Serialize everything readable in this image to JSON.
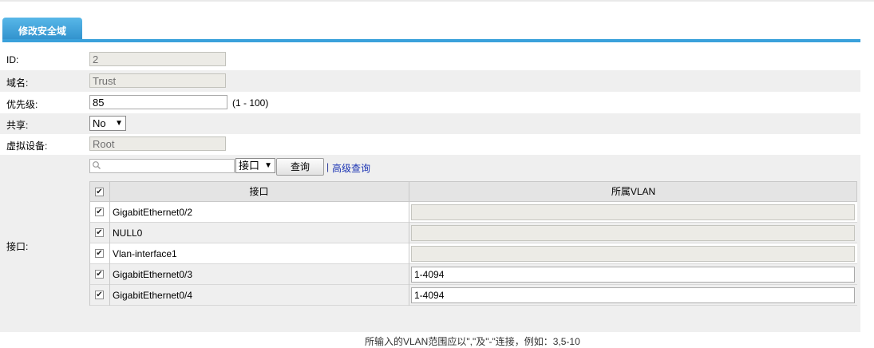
{
  "tab": {
    "title": "修改安全域"
  },
  "form": {
    "id": {
      "label": "ID:",
      "value": "2"
    },
    "domain_name": {
      "label": "域名:",
      "value": "Trust"
    },
    "priority": {
      "label": "优先级:",
      "value": "85",
      "range_hint": "(1 - 100)"
    },
    "share": {
      "label": "共享:",
      "selected": "No"
    },
    "virtual_device": {
      "label": "虚拟设备:",
      "value": "Root"
    },
    "interface": {
      "label": "接口:"
    }
  },
  "search": {
    "placeholder": "",
    "type_selected": "接口",
    "query_button": "查询",
    "separator": "|",
    "advanced_link": "高级查询"
  },
  "table": {
    "headers": {
      "interface": "接口",
      "vlan": "所属VLAN"
    },
    "rows": [
      {
        "name": "GigabitEthernet0/2",
        "vlan": "",
        "checked": true,
        "vlan_editable": false
      },
      {
        "name": "NULL0",
        "vlan": "",
        "checked": true,
        "vlan_editable": false
      },
      {
        "name": "Vlan-interface1",
        "vlan": "",
        "checked": true,
        "vlan_editable": false
      },
      {
        "name": "GigabitEthernet0/3",
        "vlan": "1-4094",
        "checked": true,
        "vlan_editable": true
      },
      {
        "name": "GigabitEthernet0/4",
        "vlan": "1-4094",
        "checked": true,
        "vlan_editable": true
      }
    ]
  },
  "footer_note": "所输入的VLAN范围应以\",\"及\"-\"连接，例如：3,5-10"
}
